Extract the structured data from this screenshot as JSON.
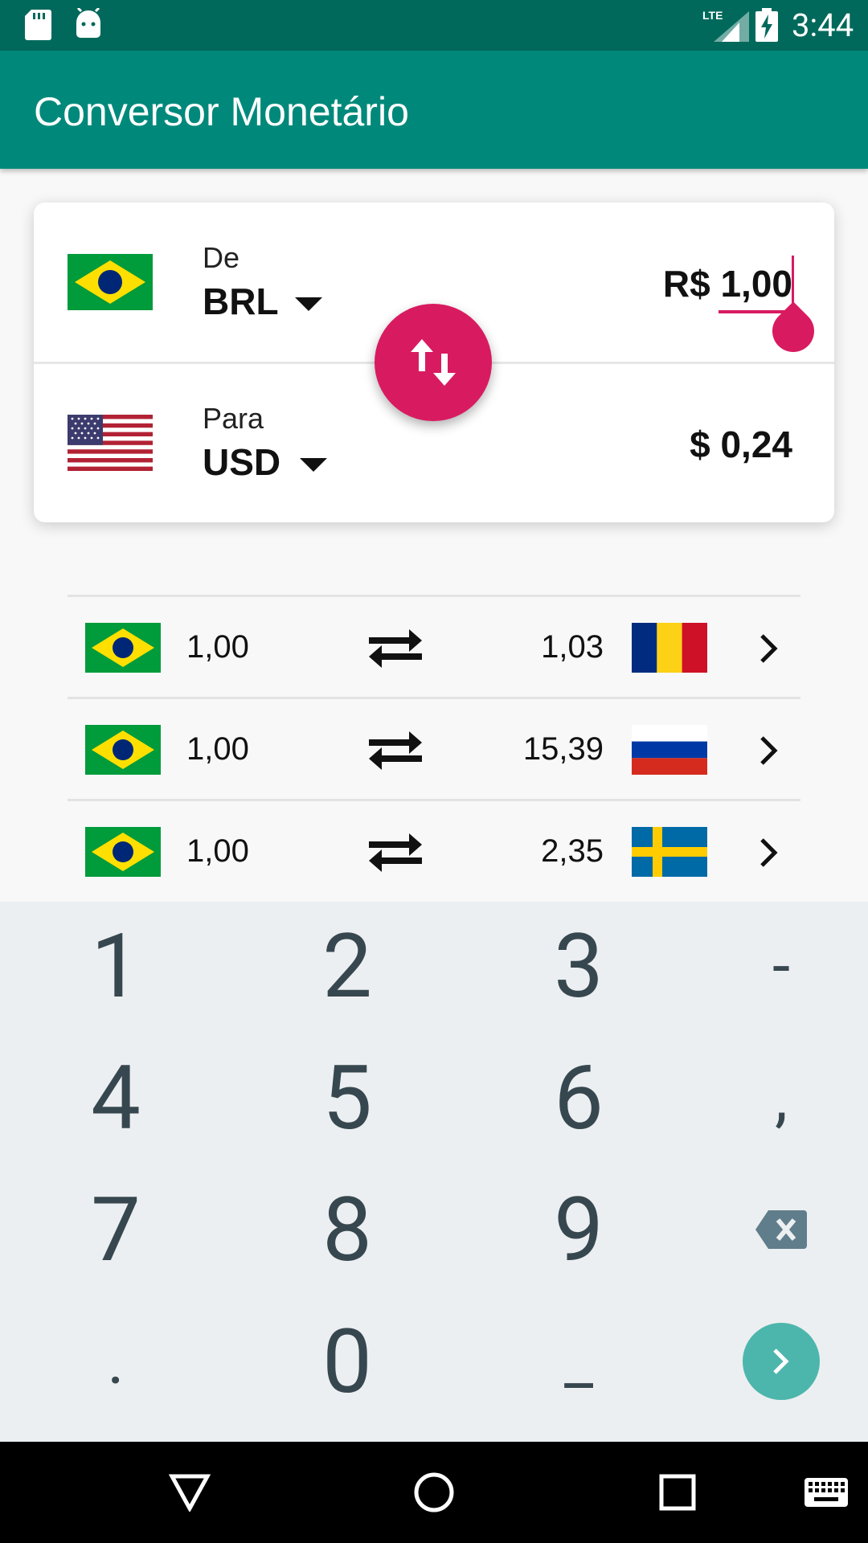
{
  "status_bar": {
    "time": "3:44",
    "network": "LTE",
    "icons": [
      "sd-card-icon",
      "android-debug-icon",
      "lte-signal-icon",
      "battery-charging-icon"
    ]
  },
  "app_bar": {
    "title": "Conversor Monetário"
  },
  "converter": {
    "from": {
      "label": "De",
      "code": "BRL",
      "flag": "brazil",
      "amount": "R$ 1,00"
    },
    "to": {
      "label": "Para",
      "code": "USD",
      "flag": "usa",
      "amount": "$ 0,24"
    },
    "swap_icon": "swap-vertical-icon",
    "accent_color": "#d81b60"
  },
  "rates": [
    {
      "base_flag": "brazil",
      "base_value": "1,00",
      "target_value": "1,03",
      "target_flag": "romania"
    },
    {
      "base_flag": "brazil",
      "base_value": "1,00",
      "target_value": "15,39",
      "target_flag": "russia"
    },
    {
      "base_flag": "brazil",
      "base_value": "1,00",
      "target_value": "2,35",
      "target_flag": "sweden"
    }
  ],
  "keyboard": {
    "keys": [
      "1",
      "2",
      "3",
      "-",
      "4",
      "5",
      "6",
      ",",
      "7",
      "8",
      "9",
      "⌫",
      ".",
      "0",
      "_",
      "›"
    ]
  },
  "colors": {
    "primary": "#00897b",
    "primary_dark": "#00695b",
    "accent": "#d81b60",
    "keyboard_bg": "#eceff1",
    "keyboard_enter": "#4db6ac"
  }
}
